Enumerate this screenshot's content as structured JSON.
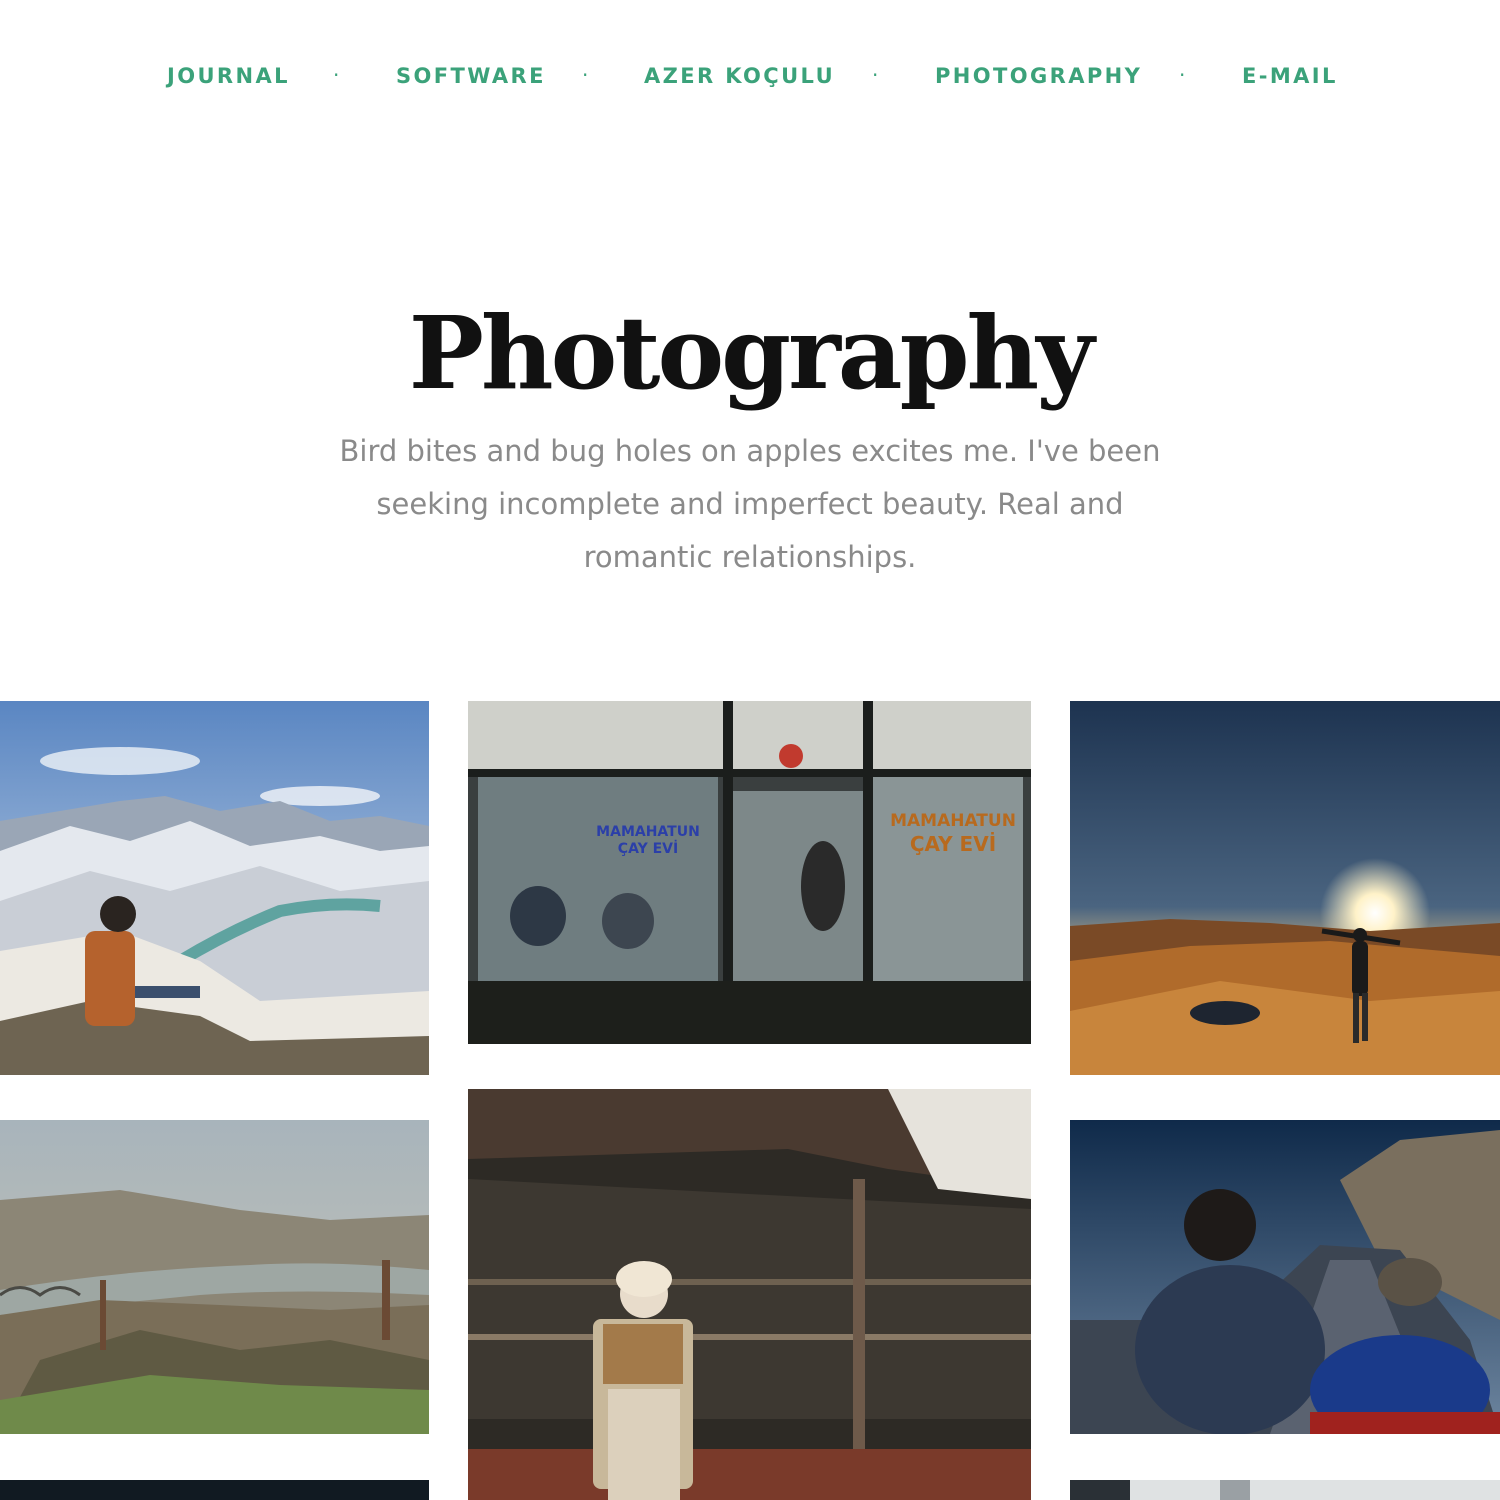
{
  "nav": {
    "items": [
      {
        "label": "JOURNAL"
      },
      {
        "label": "SOFTWARE"
      },
      {
        "label": "AZER KOÇULU"
      },
      {
        "label": "PHOTOGRAPHY"
      },
      {
        "label": "E-MAIL"
      }
    ],
    "separator": "·",
    "accent_color": "#3ba27a"
  },
  "header": {
    "title": "Photography",
    "tagline": "Bird bites and bug holes on apples excites me. I've been seeking incomplete and imperfect beauty. Real and romantic relationships."
  },
  "gallery": {
    "photos": [
      {
        "subject": "snowy-mountain-valley"
      },
      {
        "subject": "tea-house-window",
        "sign_left": "MAMAHATUN\nÇAY EVİ",
        "sign_right": "MAMAHATUN\nÇAY EVİ"
      },
      {
        "subject": "desert-sunset"
      },
      {
        "subject": "river-town-aerial"
      },
      {
        "subject": "man-in-headscarf-under-tent"
      },
      {
        "subject": "motorcycle-riders-at-dusk"
      },
      {
        "subject": "dark-photo"
      },
      {
        "subject": "light-photo"
      }
    ]
  }
}
